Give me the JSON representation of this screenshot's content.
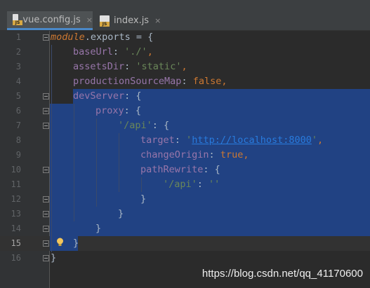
{
  "tabs": [
    {
      "label": "vue.config.js",
      "icon": "js-file-icon",
      "active": true
    },
    {
      "label": "index.js",
      "icon": "js-file-icon",
      "active": false
    }
  ],
  "file_badge": "JS",
  "close_glyph": "×",
  "lines": [
    {
      "n": "1"
    },
    {
      "n": "2"
    },
    {
      "n": "3"
    },
    {
      "n": "4"
    },
    {
      "n": "5"
    },
    {
      "n": "6"
    },
    {
      "n": "7"
    },
    {
      "n": "8"
    },
    {
      "n": "9"
    },
    {
      "n": "10"
    },
    {
      "n": "11"
    },
    {
      "n": "12"
    },
    {
      "n": "13"
    },
    {
      "n": "14"
    },
    {
      "n": "15"
    },
    {
      "n": "16"
    }
  ],
  "code": {
    "l1": {
      "module": "module",
      "rest": ".exports = {"
    },
    "l2": {
      "key": "baseUrl",
      "sep": ": ",
      "val": "'./'",
      "end": ","
    },
    "l3": {
      "key": "assetsDir",
      "sep": ": ",
      "val": "'static'",
      "end": ","
    },
    "l4": {
      "key": "productionSourceMap",
      "sep": ": ",
      "val": "false",
      "end": ","
    },
    "l5": {
      "key": "devServer",
      "rest": ": {"
    },
    "l6": {
      "key": "proxy",
      "rest": ": {"
    },
    "l7": {
      "key": "'/api'",
      "rest": ": {"
    },
    "l8": {
      "key": "target",
      "sep": ": ",
      "q1": "'",
      "url": "http://localhost:8000",
      "q2": "'",
      "end": ","
    },
    "l9": {
      "key": "changeOrigin",
      "sep": ": ",
      "val": "true",
      "end": ","
    },
    "l10": {
      "key": "pathRewrite",
      "rest": ": {"
    },
    "l11": {
      "key": "'/api'",
      "sep": ": ",
      "val": "''"
    },
    "l12": {
      "text": "}"
    },
    "l13": {
      "text": "}"
    },
    "l14": {
      "text": "}"
    },
    "l15": {
      "text": "}"
    },
    "l16": {
      "text": "}"
    }
  },
  "watermark": "https://blog.csdn.net/qq_41170600",
  "colors": {
    "background": "#2b2b2b",
    "selection": "#214283",
    "keyword": "#cc7832",
    "property": "#9876aa",
    "string": "#6a8759",
    "url": "#287bde"
  }
}
